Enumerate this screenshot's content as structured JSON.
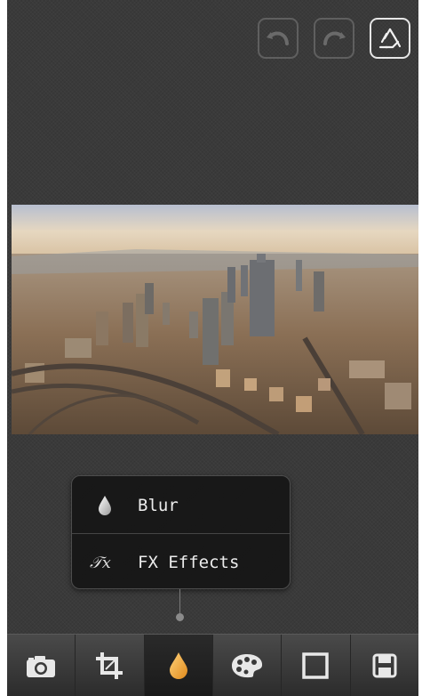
{
  "top_bar": {
    "undo_icon": "undo-arrow-icon",
    "redo_icon": "redo-arrow-icon",
    "reset_icon": "recycle-icon"
  },
  "photo": {
    "subject": "aerial city skyline"
  },
  "effects_menu": {
    "items": [
      {
        "label": "Blur",
        "icon": "droplet-icon"
      },
      {
        "label": "FX Effects",
        "icon": "fx-icon"
      }
    ]
  },
  "toolbar": {
    "items": [
      {
        "icon": "camera-icon"
      },
      {
        "icon": "crop-icon"
      },
      {
        "icon": "droplet-icon",
        "active": true
      },
      {
        "icon": "palette-icon"
      },
      {
        "icon": "frame-icon"
      },
      {
        "icon": "save-icon"
      }
    ]
  },
  "colors": {
    "accent": "#f2a23a",
    "background": "#3a3a3a"
  }
}
